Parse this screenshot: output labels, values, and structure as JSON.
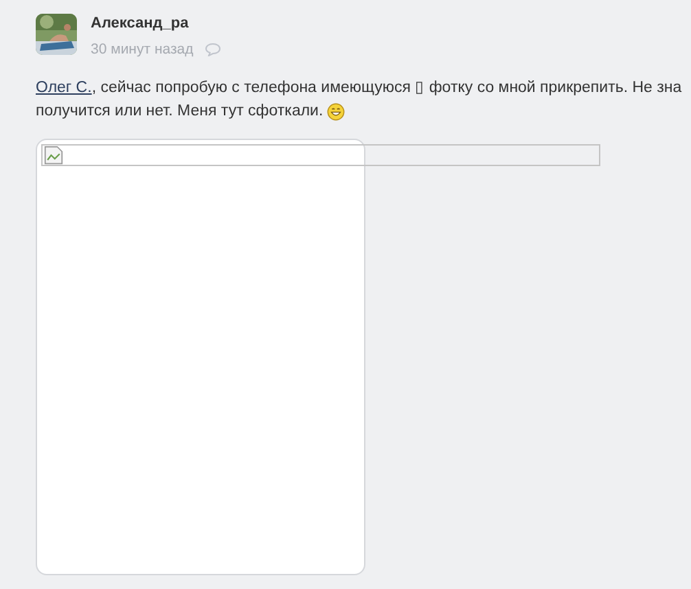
{
  "post": {
    "author": "Александ_ра",
    "time": "30 минут назад",
    "mention": "Олег С.",
    "text_line_1": ", сейчас попробую с телефона имеющуюся ▯ фотку со мной прикрепить. Не зна",
    "text_line_2": "получится или нет. Меня тут сфоткали.",
    "attachment": {
      "kind": "broken-image"
    }
  }
}
